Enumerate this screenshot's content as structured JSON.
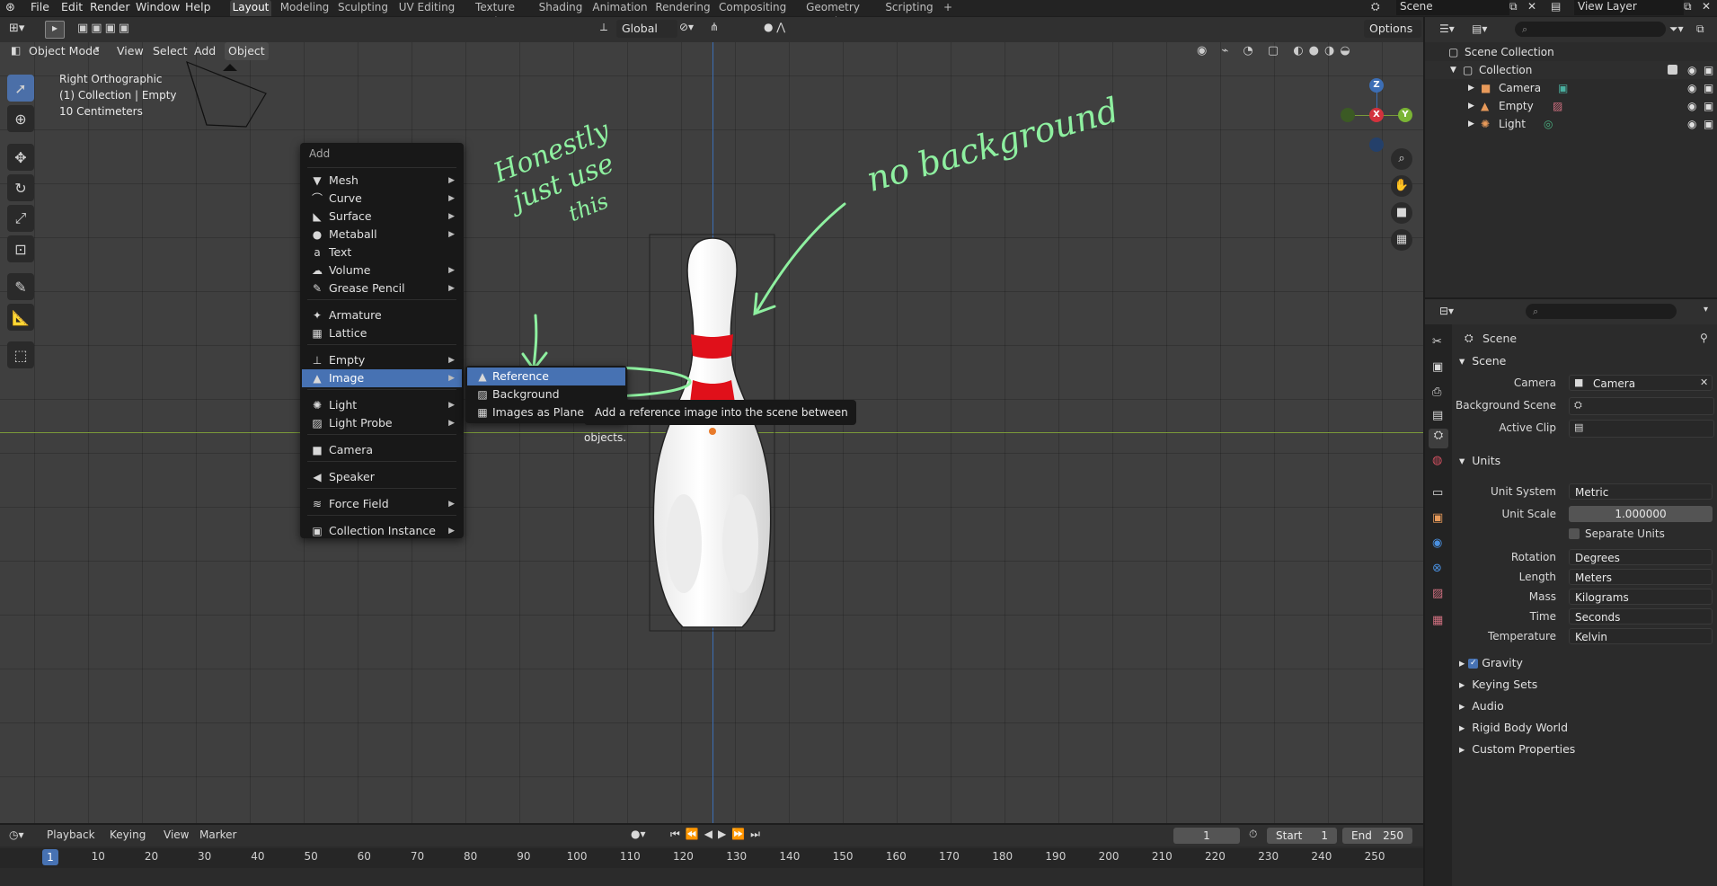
{
  "topbar": {
    "menus": [
      "File",
      "Edit",
      "Render",
      "Window",
      "Help"
    ],
    "workspaces": [
      "Layout",
      "Modeling",
      "Sculpting",
      "UV Editing",
      "Texture Paint",
      "Shading",
      "Animation",
      "Rendering",
      "Compositing",
      "Geometry Nodes",
      "Scripting"
    ],
    "scene_label": "Scene",
    "view_layer_label": "View Layer"
  },
  "viewport_header": {
    "mode": "Object Mode",
    "menus": [
      "View",
      "Select",
      "Add",
      "Object"
    ],
    "transform_orientation": "Global",
    "options": "Options"
  },
  "viewport_overlay": {
    "view_name": "Right Orthographic",
    "collection_info": "(1) Collection | Empty",
    "scale": "10 Centimeters"
  },
  "gizmo": {
    "z": "Z",
    "x": "X",
    "y": "Y"
  },
  "add_menu": {
    "title": "Add",
    "items": [
      {
        "label": "Mesh",
        "icon": "mesh-icon",
        "glyph": "▼",
        "submenu": true
      },
      {
        "label": "Curve",
        "icon": "curve-icon",
        "glyph": "⌒",
        "submenu": true
      },
      {
        "label": "Surface",
        "icon": "surface-icon",
        "glyph": "◣",
        "submenu": true
      },
      {
        "label": "Metaball",
        "icon": "metaball-icon",
        "glyph": "●",
        "submenu": true
      },
      {
        "label": "Text",
        "icon": "text-icon",
        "glyph": "a",
        "submenu": false
      },
      {
        "label": "Volume",
        "icon": "volume-icon",
        "glyph": "☁",
        "submenu": true
      },
      {
        "label": "Grease Pencil",
        "icon": "grease-pencil-icon",
        "glyph": "✎",
        "submenu": true
      },
      {
        "label": "Armature",
        "icon": "armature-icon",
        "glyph": "✦",
        "submenu": false
      },
      {
        "label": "Lattice",
        "icon": "lattice-icon",
        "glyph": "▦",
        "submenu": false
      },
      {
        "label": "Empty",
        "icon": "empty-icon",
        "glyph": "⊥",
        "submenu": true
      },
      {
        "label": "Image",
        "icon": "image-icon",
        "glyph": "▲",
        "submenu": true
      },
      {
        "label": "Light",
        "icon": "light-icon",
        "glyph": "✺",
        "submenu": true
      },
      {
        "label": "Light Probe",
        "icon": "light-probe-icon",
        "glyph": "▨",
        "submenu": true
      },
      {
        "label": "Camera",
        "icon": "camera-icon",
        "glyph": "■",
        "submenu": false
      },
      {
        "label": "Speaker",
        "icon": "speaker-icon",
        "glyph": "◀",
        "submenu": false
      },
      {
        "label": "Force Field",
        "icon": "force-field-icon",
        "glyph": "≋",
        "submenu": true
      },
      {
        "label": "Collection Instance",
        "icon": "collection-instance-icon",
        "glyph": "▣",
        "submenu": true
      }
    ]
  },
  "image_submenu": {
    "items": [
      "Reference",
      "Background",
      "Images as Planes"
    ]
  },
  "tooltip": "Add a reference image into the scene between objects.",
  "annotations": {
    "note_left": [
      "Honestly",
      "just use",
      "this"
    ],
    "note_right": "no background"
  },
  "outliner": {
    "scene_collection": "Scene Collection",
    "collection": "Collection",
    "objects": [
      "Camera",
      "Empty",
      "Light"
    ]
  },
  "properties": {
    "tab_title": "Scene",
    "scene_section": "Scene",
    "camera_label": "Camera",
    "camera_value": "Camera",
    "background_scene_label": "Background Scene",
    "active_clip_label": "Active Clip",
    "units_section": "Units",
    "unit_system_label": "Unit System",
    "unit_system_value": "Metric",
    "unit_scale_label": "Unit Scale",
    "unit_scale_value": "1.000000",
    "separate_units_label": "Separate Units",
    "rotation_label": "Rotation",
    "rotation_value": "Degrees",
    "length_label": "Length",
    "length_value": "Meters",
    "mass_label": "Mass",
    "mass_value": "Kilograms",
    "time_label": "Time",
    "time_value": "Seconds",
    "temperature_label": "Temperature",
    "temperature_value": "Kelvin",
    "collapsed_sections": [
      "Gravity",
      "Keying Sets",
      "Audio",
      "Rigid Body World",
      "Custom Properties"
    ]
  },
  "timeline": {
    "menus": [
      "Playback",
      "Keying",
      "View",
      "Marker"
    ],
    "current_frame": "1",
    "start_label": "Start",
    "start_value": "1",
    "end_label": "End",
    "end_value": "250",
    "ruler": [
      "1",
      "10",
      "20",
      "30",
      "40",
      "50",
      "60",
      "70",
      "80",
      "90",
      "100",
      "110",
      "120",
      "130",
      "140",
      "150",
      "160",
      "170",
      "180",
      "190",
      "200",
      "210",
      "220",
      "230",
      "240",
      "250"
    ]
  },
  "colors": {
    "accent": "#4772b3",
    "annotation": "#8ef0a0",
    "stripe": "#e0101a"
  }
}
